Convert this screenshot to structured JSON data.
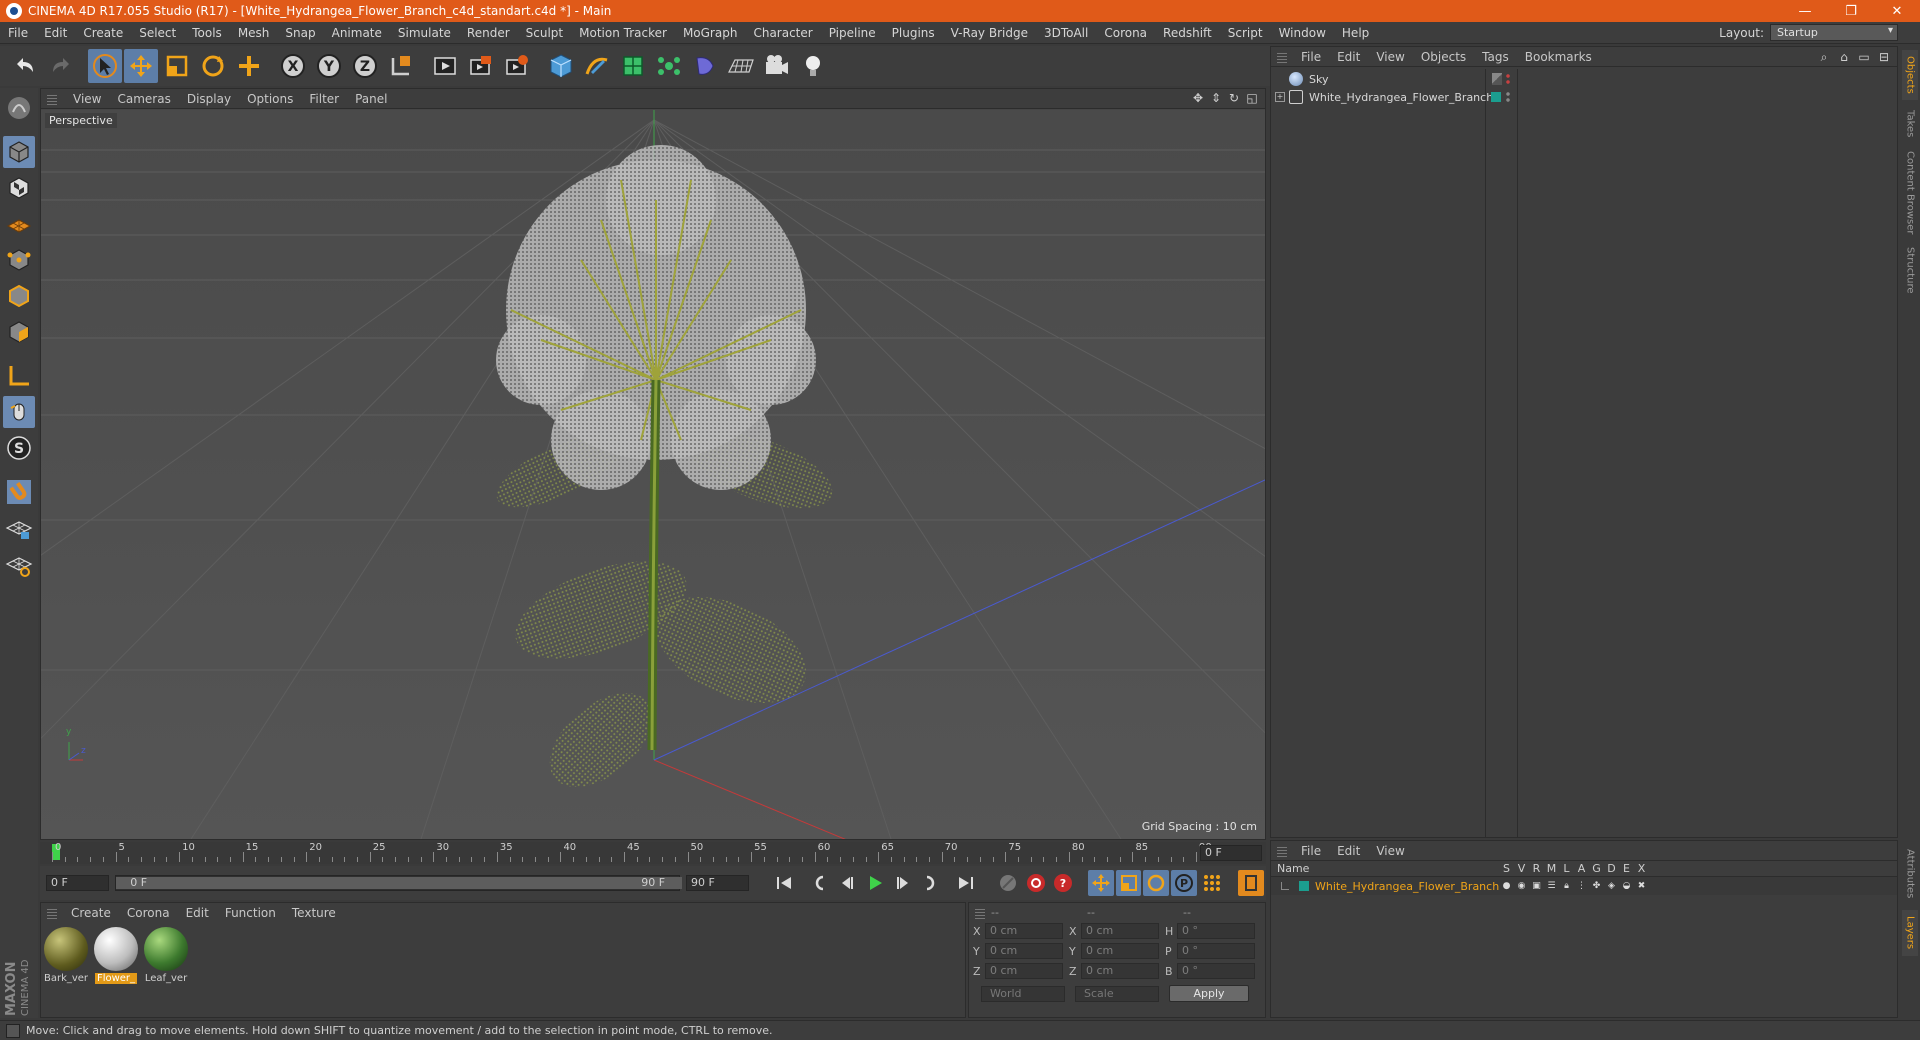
{
  "window": {
    "title": "CINEMA 4D R17.055 Studio (R17) - [White_Hydrangea_Flower_Branch_c4d_standart.c4d *] - Main",
    "controls": [
      "—",
      "❐",
      "✕"
    ]
  },
  "menubar": {
    "items": [
      "File",
      "Edit",
      "Create",
      "Select",
      "Tools",
      "Mesh",
      "Snap",
      "Animate",
      "Simulate",
      "Render",
      "Sculpt",
      "Motion Tracker",
      "MoGraph",
      "Character",
      "Pipeline",
      "Plugins",
      "V-Ray Bridge",
      "3DToAll",
      "Corona",
      "Redshift",
      "Script",
      "Window",
      "Help"
    ],
    "layout_label": "Layout:",
    "layout_value": "Startup"
  },
  "toolbar": {
    "icons": [
      "undo-icon",
      "redo-icon",
      "select-arrow-icon",
      "move-icon",
      "scale-icon",
      "rotate-icon",
      "move-plus-icon",
      "x-axis-icon",
      "y-axis-icon",
      "z-axis-icon",
      "coordinate-system-icon",
      "render-view-icon",
      "render-picture-viewer-icon",
      "render-settings-icon",
      "cube-icon",
      "pen-spline-icon",
      "subdivision-icon",
      "mograph-cloner-icon",
      "deformer-icon",
      "floor-grid-icon",
      "camera-icon",
      "light-icon"
    ]
  },
  "viewport": {
    "menu": [
      "View",
      "Cameras",
      "Display",
      "Options",
      "Filter",
      "Panel"
    ],
    "label": "Perspective",
    "grid_spacing": "Grid Spacing : 10 cm",
    "axis_labels": {
      "y": "y",
      "z": "z"
    }
  },
  "timeline": {
    "ticks": [
      "0",
      "5",
      "10",
      "15",
      "20",
      "25",
      "30",
      "35",
      "40",
      "45",
      "50",
      "55",
      "60",
      "65",
      "70",
      "75",
      "80",
      "85",
      "90"
    ],
    "current_frame": "0 F"
  },
  "playback": {
    "start": "0 F",
    "slider_start": "0 F",
    "slider_end": "90 F",
    "end": "90 F"
  },
  "material_manager": {
    "menu": [
      "Create",
      "Corona",
      "Edit",
      "Function",
      "Texture"
    ],
    "materials": [
      {
        "name": "Bark_ver",
        "color": "#7a7a2e",
        "selected": false
      },
      {
        "name": "Flower_",
        "color": "#d8d8d8",
        "selected": true
      },
      {
        "name": "Leaf_ver",
        "color": "#3d7a2e",
        "selected": false
      }
    ]
  },
  "brand": {
    "top": "MAXON",
    "bottom": "CINEMA 4D"
  },
  "coordinates": {
    "headers": [
      "--",
      "--",
      "--"
    ],
    "rows": [
      {
        "a1": "X",
        "v1": "0 cm",
        "a2": "X",
        "v2": "0 cm",
        "a3": "H",
        "v3": "0 °"
      },
      {
        "a1": "Y",
        "v1": "0 cm",
        "a2": "Y",
        "v2": "0 cm",
        "a3": "P",
        "v3": "0 °"
      },
      {
        "a1": "Z",
        "v1": "0 cm",
        "a2": "Z",
        "v2": "0 cm",
        "a3": "B",
        "v3": "0 °"
      }
    ],
    "mode": "World",
    "type": "Scale",
    "apply": "Apply"
  },
  "statusbar": {
    "text": "Move: Click and drag to move elements. Hold down SHIFT to quantize movement / add to the selection in point mode, CTRL to remove."
  },
  "object_manager": {
    "menu": [
      "File",
      "Edit",
      "View",
      "Objects",
      "Tags",
      "Bookmarks"
    ],
    "objects": [
      {
        "name": "Sky",
        "icon": "sky-icon"
      },
      {
        "name": "White_Hydrangea_Flower_Branch",
        "icon": "null-object-icon"
      }
    ]
  },
  "layer_manager": {
    "menu": [
      "File",
      "Edit",
      "View"
    ],
    "header_name": "Name",
    "columns": [
      "S",
      "V",
      "R",
      "M",
      "L",
      "A",
      "G",
      "D",
      "E",
      "X"
    ],
    "layers": [
      {
        "name": "White_Hydrangea_Flower_Branch",
        "color": "#1b9e8f"
      }
    ]
  },
  "side_tabs": [
    "Objects",
    "Takes",
    "Content Browser",
    "Structure",
    "Attributes",
    "Layers"
  ],
  "colors": {
    "title_bar": "#e05a19",
    "accent_orange": "#f0a419",
    "active_blue": "#5d7ea8",
    "panel_bg": "#3d3d3d",
    "viewport_bg": "#464646"
  }
}
